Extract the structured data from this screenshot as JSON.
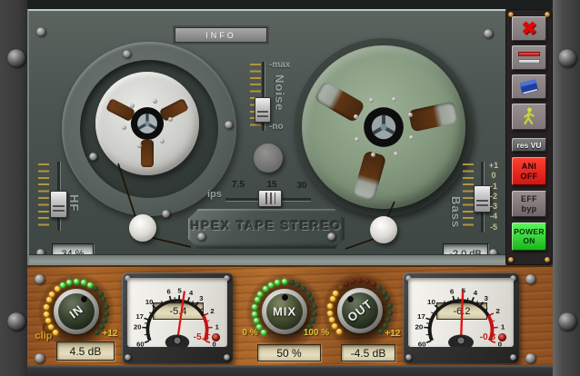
{
  "window": {
    "info_label": "INFO",
    "plate_label": "HPEX TAPE STEREO"
  },
  "icons": {
    "close": "✖"
  },
  "deck": {
    "hf": {
      "label": "HF",
      "display": "34 %"
    },
    "noise": {
      "label": "Noise",
      "top_label": "-max",
      "bottom_label": "-no"
    },
    "bass": {
      "label": "Bass",
      "display": "-2.0 dB",
      "scale": [
        "+1",
        "0",
        "-1",
        "-2",
        "-3",
        "-4",
        "-5"
      ]
    },
    "ips": {
      "label": "ips",
      "options": [
        "7.5",
        "15",
        "30"
      ],
      "selected": "15"
    }
  },
  "side_buttons": {
    "res_vu": "res VU",
    "ani_line1": "ANI",
    "ani_line2": "OFF",
    "eff_line1": "EFF",
    "eff_line2": "byp",
    "power_line1": "POWER",
    "power_line2": "ON"
  },
  "knobs": {
    "in": {
      "label": "IN",
      "display": "4.5 dB",
      "max_label": "+12",
      "clip_label": "clip",
      "label_rot": -38,
      "pointer_deg": 34,
      "leds": [
        "y",
        "y",
        "y",
        "y",
        "y",
        "y",
        "y",
        "y",
        "g",
        "g",
        "g",
        "g",
        "g",
        "dg",
        "dg",
        "dg",
        "dg",
        "dg",
        "dg",
        "dg",
        "dg"
      ]
    },
    "mix": {
      "label": "MIX",
      "display": "50 %",
      "min_label": "0 %",
      "max_label": "100 %",
      "label_rot": 0,
      "pointer_deg": 0,
      "leds": [
        "g",
        "g",
        "g",
        "g",
        "g",
        "g",
        "g",
        "g",
        "g",
        "g",
        "g",
        "dg",
        "dg",
        "dg",
        "dg",
        "dg",
        "dg",
        "dg",
        "dg",
        "dg",
        "dg"
      ]
    },
    "out": {
      "label": "OUT",
      "display": "-4.5 dB",
      "max_label": "+12",
      "label_rot": -38,
      "pointer_deg": -40,
      "leds": [
        "y",
        "y",
        "y",
        "y",
        "y",
        "y",
        "y",
        "do",
        "dr",
        "dr",
        "dr",
        "dr",
        "dr",
        "dg",
        "dg",
        "dg",
        "dg",
        "dg",
        "dg",
        "dg",
        "dg"
      ]
    }
  },
  "meters": {
    "scale_labels": [
      "60",
      "20",
      "17",
      "10",
      "6",
      "5",
      "4",
      "3",
      "2",
      "1",
      "0"
    ],
    "left": {
      "lcd": "-5.4",
      "peak": "-5.4",
      "needle_deg": 82
    },
    "right": {
      "lcd": "-6.2",
      "peak": "-0.8",
      "needle_deg": 88
    }
  },
  "colors": {
    "accent_red": "#d42020",
    "accent_green": "#2ed22e",
    "amber": "#f0a818",
    "wood": "#a05a24"
  }
}
